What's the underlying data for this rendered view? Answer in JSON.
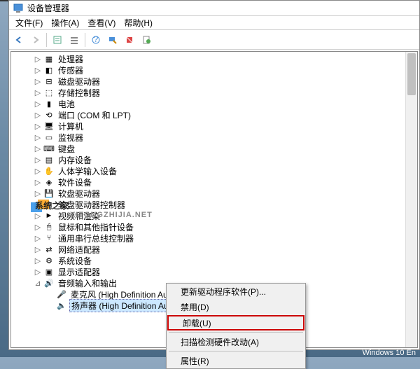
{
  "window": {
    "title": "设备管理器"
  },
  "menu": {
    "file": "文件(F)",
    "action": "操作(A)",
    "view": "查看(V)",
    "help": "帮助(H)"
  },
  "tree": {
    "items": [
      {
        "label": "处理器",
        "depth": 1,
        "icon": "cpu"
      },
      {
        "label": "传感器",
        "depth": 1,
        "icon": "sensor"
      },
      {
        "label": "磁盘驱动器",
        "depth": 1,
        "icon": "disk"
      },
      {
        "label": "存储控制器",
        "depth": 1,
        "icon": "storage"
      },
      {
        "label": "电池",
        "depth": 1,
        "icon": "battery"
      },
      {
        "label": "端口 (COM 和 LPT)",
        "depth": 1,
        "icon": "port"
      },
      {
        "label": "计算机",
        "depth": 1,
        "icon": "computer"
      },
      {
        "label": "监视器",
        "depth": 1,
        "icon": "monitor"
      },
      {
        "label": "键盘",
        "depth": 1,
        "icon": "keyboard"
      },
      {
        "label": "内存设备",
        "depth": 1,
        "icon": "memory"
      },
      {
        "label": "人体学输入设备",
        "depth": 1,
        "icon": "hid"
      },
      {
        "label": "软件设备",
        "depth": 1,
        "icon": "software"
      },
      {
        "label": "软盘驱动器",
        "depth": 1,
        "icon": "floppy"
      },
      {
        "label": "软盘驱动器控制器",
        "depth": 1,
        "icon": "floppyctl"
      },
      {
        "label": "视频和渲染",
        "depth": 1,
        "icon": "video"
      },
      {
        "label": "鼠标和其他指针设备",
        "depth": 1,
        "icon": "mouse"
      },
      {
        "label": "通用串行总线控制器",
        "depth": 1,
        "icon": "usb"
      },
      {
        "label": "网络适配器",
        "depth": 1,
        "icon": "network"
      },
      {
        "label": "系统设备",
        "depth": 1,
        "icon": "system"
      },
      {
        "label": "显示适配器",
        "depth": 1,
        "icon": "display"
      },
      {
        "label": "音频输入和输出",
        "depth": 1,
        "icon": "audio",
        "expanded": true
      },
      {
        "label": "麦克风 (High Definition Audio 设备)",
        "depth": 2,
        "icon": "mic"
      },
      {
        "label": "扬声器 (High Definition Audio 设备)",
        "depth": 2,
        "icon": "speaker",
        "selected": true
      }
    ]
  },
  "context_menu": {
    "update": "更新驱动程序软件(P)...",
    "disable": "禁用(D)",
    "uninstall": "卸载(U)",
    "scan": "扫描检测硬件改动(A)",
    "properties": "属性(R)"
  },
  "watermark": {
    "main": "系统之家",
    "sub": "XITONGZHIJIA.NET"
  },
  "footer": "Windows 10 En",
  "icons": {
    "cpu": "▦",
    "sensor": "◧",
    "disk": "⊟",
    "storage": "⬚",
    "battery": "▮",
    "port": "⟲",
    "computer": "🖥",
    "monitor": "▭",
    "keyboard": "⌨",
    "memory": "▤",
    "hid": "✋",
    "software": "◈",
    "floppy": "💾",
    "floppyctl": "⊡",
    "video": "►",
    "mouse": "🖱",
    "usb": "⑂",
    "network": "⇄",
    "system": "⚙",
    "display": "▣",
    "audio": "🔊",
    "mic": "🎤",
    "speaker": "🔈"
  }
}
